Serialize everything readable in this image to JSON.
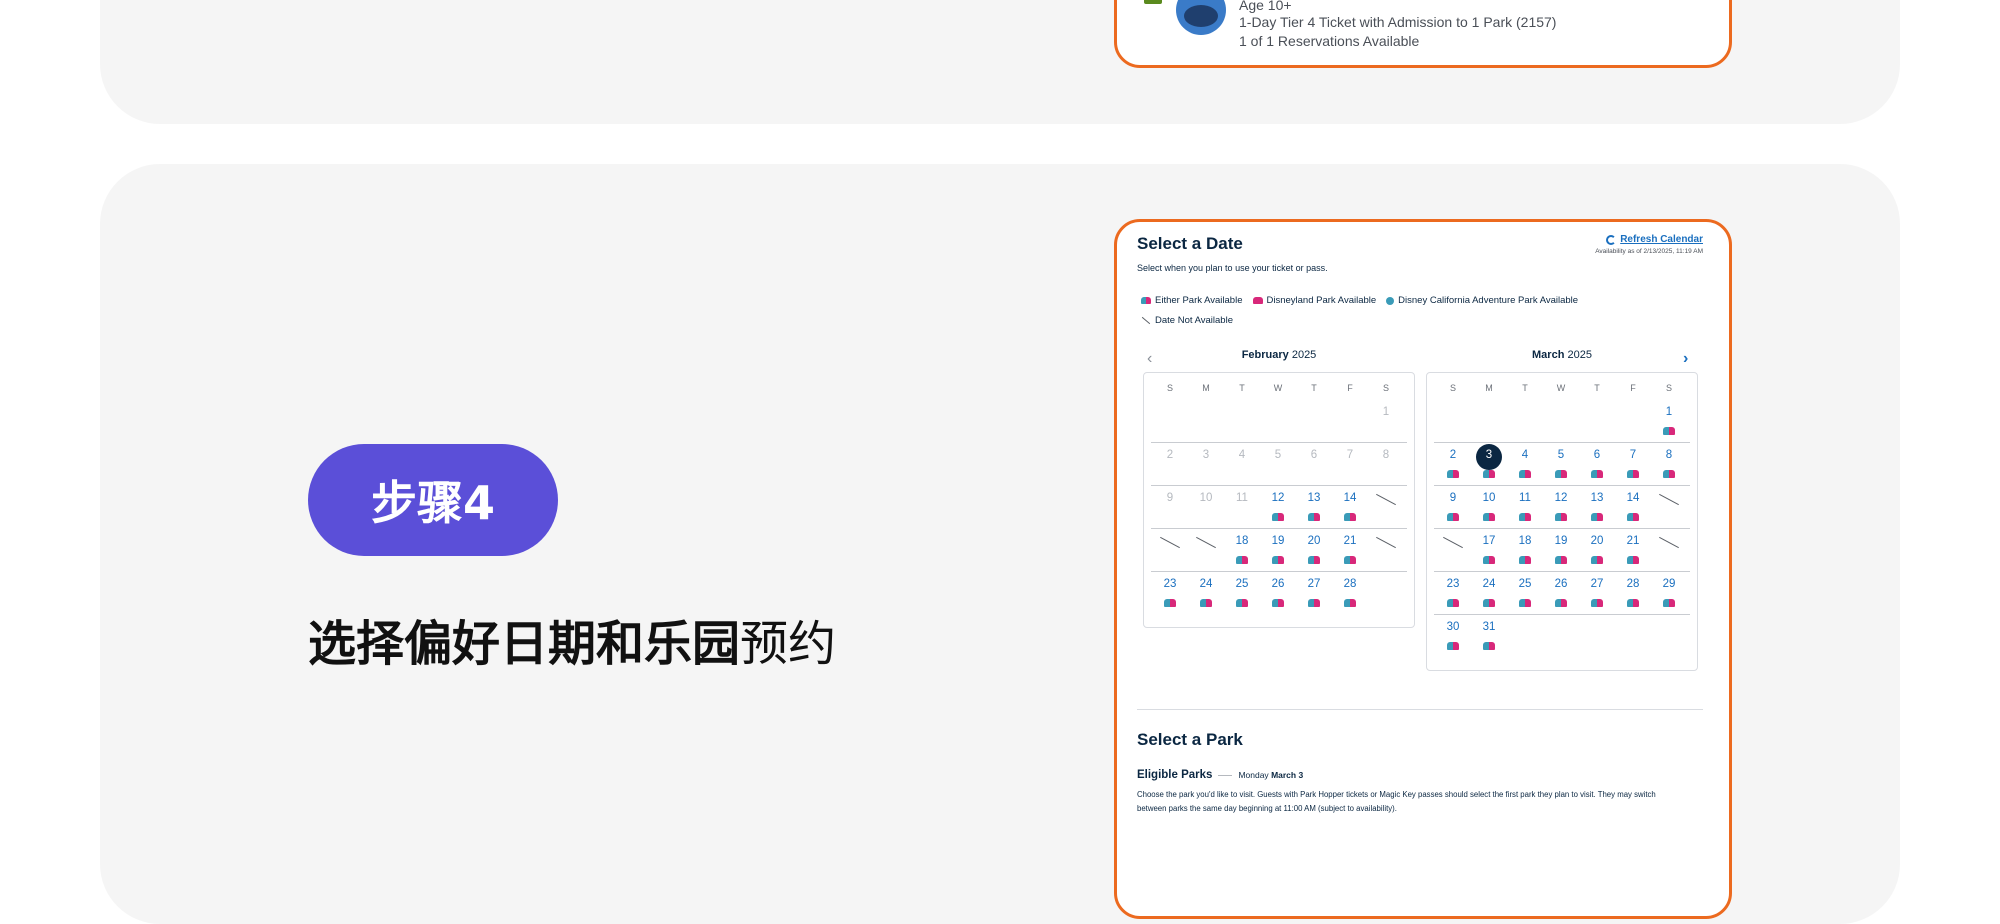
{
  "top_ticket": {
    "age_label": "Age 10+",
    "ticket_type": "1-Day Tier 4 Ticket with Admission to 1 Park (2157)",
    "reservations": "1 of 1 Reservations Available"
  },
  "step": {
    "badge": "步骤4",
    "title_bold": "选择偏好日期和乐园",
    "title_light": "预约"
  },
  "calendar_panel": {
    "title": "Select a Date",
    "subtitle": "Select when you plan to use your ticket or pass.",
    "refresh_label": "Refresh Calendar",
    "availability_as_of": "Availability as of 2/13/2025, 11:19 AM",
    "legend": [
      {
        "icon": "either-park-icon",
        "label": "Either Park Available"
      },
      {
        "icon": "disneyland-park-icon",
        "label": "Disneyland Park Available"
      },
      {
        "icon": "california-adventure-icon",
        "label": "Disney California Adventure Park Available"
      },
      {
        "icon": "date-unavailable-icon",
        "label": "Date Not Available"
      }
    ],
    "weekdays": [
      "S",
      "M",
      "T",
      "W",
      "T",
      "F",
      "S"
    ],
    "months": [
      {
        "name": "February",
        "year": "2025",
        "weeks": [
          [
            null,
            null,
            null,
            null,
            null,
            null,
            {
              "d": "1",
              "s": "past"
            }
          ],
          [
            {
              "d": "2",
              "s": "past"
            },
            {
              "d": "3",
              "s": "past"
            },
            {
              "d": "4",
              "s": "past"
            },
            {
              "d": "5",
              "s": "past"
            },
            {
              "d": "6",
              "s": "past"
            },
            {
              "d": "7",
              "s": "past"
            },
            {
              "d": "8",
              "s": "past"
            }
          ],
          [
            {
              "d": "9",
              "s": "past"
            },
            {
              "d": "10",
              "s": "past"
            },
            {
              "d": "11",
              "s": "past"
            },
            {
              "d": "12",
              "s": "avail"
            },
            {
              "d": "13",
              "s": "avail"
            },
            {
              "d": "14",
              "s": "avail"
            },
            {
              "d": "",
              "s": "na"
            }
          ],
          [
            {
              "d": "",
              "s": "na"
            },
            {
              "d": "",
              "s": "na"
            },
            {
              "d": "18",
              "s": "avail"
            },
            {
              "d": "19",
              "s": "avail"
            },
            {
              "d": "20",
              "s": "avail"
            },
            {
              "d": "21",
              "s": "avail"
            },
            {
              "d": "",
              "s": "na"
            }
          ],
          [
            {
              "d": "23",
              "s": "avail"
            },
            {
              "d": "24",
              "s": "avail"
            },
            {
              "d": "25",
              "s": "avail"
            },
            {
              "d": "26",
              "s": "avail"
            },
            {
              "d": "27",
              "s": "avail"
            },
            {
              "d": "28",
              "s": "avail"
            },
            null
          ]
        ]
      },
      {
        "name": "March",
        "year": "2025",
        "weeks": [
          [
            null,
            null,
            null,
            null,
            null,
            null,
            {
              "d": "1",
              "s": "avail"
            }
          ],
          [
            {
              "d": "2",
              "s": "avail"
            },
            {
              "d": "3",
              "s": "selected"
            },
            {
              "d": "4",
              "s": "avail"
            },
            {
              "d": "5",
              "s": "avail"
            },
            {
              "d": "6",
              "s": "avail"
            },
            {
              "d": "7",
              "s": "avail"
            },
            {
              "d": "8",
              "s": "avail"
            }
          ],
          [
            {
              "d": "9",
              "s": "avail"
            },
            {
              "d": "10",
              "s": "avail"
            },
            {
              "d": "11",
              "s": "avail"
            },
            {
              "d": "12",
              "s": "avail"
            },
            {
              "d": "13",
              "s": "avail"
            },
            {
              "d": "14",
              "s": "avail"
            },
            {
              "d": "",
              "s": "na"
            }
          ],
          [
            {
              "d": "",
              "s": "na"
            },
            {
              "d": "17",
              "s": "avail"
            },
            {
              "d": "18",
              "s": "avail"
            },
            {
              "d": "19",
              "s": "avail"
            },
            {
              "d": "20",
              "s": "avail"
            },
            {
              "d": "21",
              "s": "avail"
            },
            {
              "d": "",
              "s": "na"
            }
          ],
          [
            {
              "d": "23",
              "s": "avail"
            },
            {
              "d": "24",
              "s": "avail"
            },
            {
              "d": "25",
              "s": "avail"
            },
            {
              "d": "26",
              "s": "avail"
            },
            {
              "d": "27",
              "s": "avail"
            },
            {
              "d": "28",
              "s": "avail"
            },
            {
              "d": "29",
              "s": "avail"
            }
          ],
          [
            {
              "d": "30",
              "s": "avail"
            },
            {
              "d": "31",
              "s": "avail"
            },
            null,
            null,
            null,
            null,
            null
          ]
        ]
      }
    ]
  },
  "park_panel": {
    "title": "Select a Park",
    "eligible_label": "Eligible Parks",
    "date_weekday": "Monday",
    "date_day": "March 3",
    "description": "Choose the park you'd like to visit. Guests with Park Hopper tickets or Magic Key passes should select the first park they plan to visit. They may switch between parks the same day beginning at 11:00 AM (subject to availability)."
  },
  "colors": {
    "accent_orange": "#ec6a1f",
    "step_purple": "#5b4fd8",
    "link_blue": "#1a6fbf",
    "navy": "#0b2742"
  }
}
